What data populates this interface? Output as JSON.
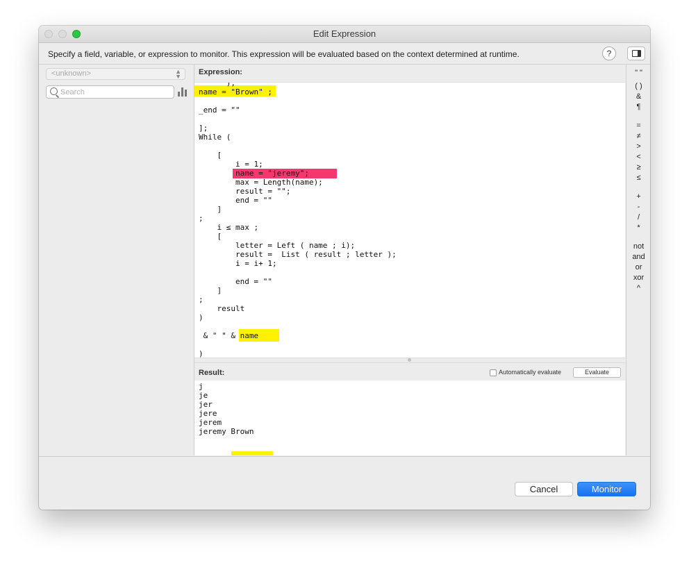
{
  "window": {
    "title": "Edit Expression"
  },
  "infobar": {
    "text": "Specify a field, variable, or expression to monitor. This expression will be evaluated based on the context determined at runtime.",
    "help_label": "?"
  },
  "leftpane": {
    "popup_value": "<unknown>",
    "search_placeholder": "Search"
  },
  "expression": {
    "label": "Expression:",
    "code_lines": [
      "      );",
      "name = \"Brown\" ;",
      "",
      "_end = \"\"",
      "",
      "];",
      "While (",
      "",
      "    [",
      "        i = 1;",
      "        name = \"jeremy\";",
      "        max = Length(name);",
      "        result = \"\";",
      "        end = \"\"",
      "    ]",
      ";",
      "    i ≤ max ;",
      "    [",
      "        letter = Left ( name ; i);",
      "        result =  List ( result ; letter );",
      "        i = i+ 1;",
      "",
      "        end = \"\"",
      "    ]",
      ";",
      "    result",
      ")",
      "",
      " & \" \" & name",
      "",
      ")"
    ]
  },
  "result": {
    "label": "Result:",
    "auto_evaluate_label": "Automatically evaluate",
    "auto_evaluate_checked": false,
    "evaluate_button": "Evaluate",
    "lines": [
      "j",
      "je",
      "jer",
      "jere",
      "jerem",
      "jeremy Brown"
    ]
  },
  "operators": [
    "\" \"",
    "( )",
    "&",
    "¶",
    "=",
    "≠",
    ">",
    "<",
    "≥",
    "≤",
    "+",
    "-",
    "/",
    "*",
    "not",
    "and",
    "or",
    "xor",
    "^"
  ],
  "footer": {
    "cancel_label": "Cancel",
    "monitor_label": "Monitor"
  },
  "colors": {
    "highlight_yellow": "#fff100",
    "highlight_pink": "#f5376f",
    "accent_blue": "#1773f0"
  }
}
